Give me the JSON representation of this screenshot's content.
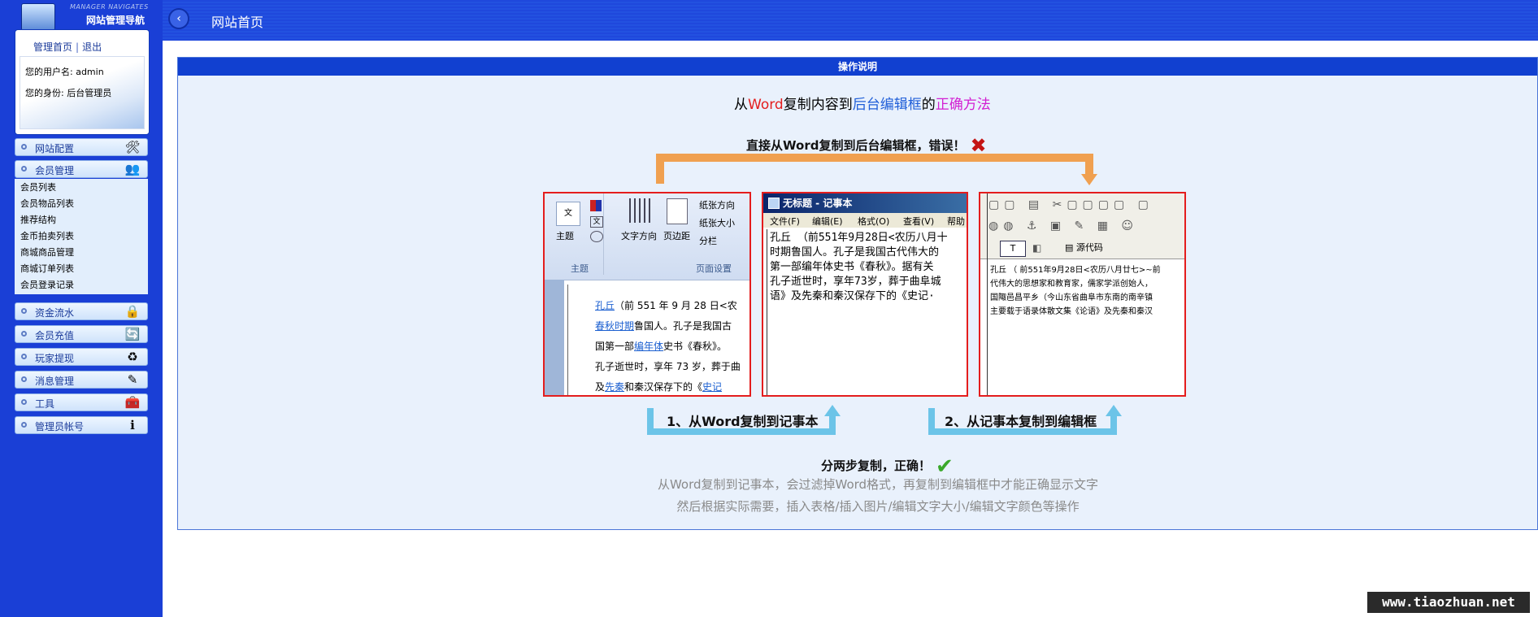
{
  "sidebar": {
    "logo_subtitle": "MANAGER NAVIGATES",
    "logo_title": "网站管理导航",
    "links": {
      "home": "管理首页",
      "sep": "|",
      "logout": "退出"
    },
    "user_line": "您的用户名: admin",
    "role_line": "您的身份: 后台管理员",
    "menus": [
      {
        "label": "网站配置",
        "icon": "tools-icon"
      },
      {
        "label": "会员管理",
        "icon": "users-icon"
      },
      {
        "label": "资金流水",
        "icon": "lock-icon"
      },
      {
        "label": "会员充值",
        "icon": "refresh-icon"
      },
      {
        "label": "玩家提现",
        "icon": "recycle-icon"
      },
      {
        "label": "消息管理",
        "icon": "edit-icon"
      },
      {
        "label": "工具",
        "icon": "toolbox-icon"
      },
      {
        "label": "管理员帐号",
        "icon": "info-icon"
      }
    ],
    "submenu": [
      "会员列表",
      "会员物品列表",
      "推荐结构",
      "金币拍卖列表",
      "商城商品管理",
      "商城订单列表",
      "会员登录记录"
    ]
  },
  "header": {
    "back_icon": "back-arrow-icon",
    "title": "网站首页"
  },
  "panel": {
    "heading": "操作说明",
    "main_title": {
      "p1": "从",
      "p2": "Word",
      "p3": "复制内容到",
      "p4": "后台编辑框",
      "p5": "的",
      "p6": "正确方法"
    },
    "wrong_label": "直接从Word复制到后台编辑框，错误！",
    "word_shot": {
      "ribbon": [
        "主题",
        "文字方向",
        "页边距",
        "纸张方向",
        "纸张大小",
        "分栏"
      ],
      "groups": [
        "主题",
        "页面设置"
      ],
      "text_l1a": "孔丘",
      "text_l1b": "（前 551 年 9 月 28 日<农",
      "text_l2a": "春秋时期",
      "text_l2b": "鲁国人。孔子是我国古",
      "text_l3a": "国第一部",
      "text_l3b": "编年体",
      "text_l3c": "史书《春秋》。",
      "text_l4": "孔子逝世时，享年 73 岁，葬于曲",
      "text_l5a": "及",
      "text_l5b": "先秦",
      "text_l5c": "和秦汉保存下的《",
      "text_l5d": "史记"
    },
    "notepad_shot": {
      "title": "无标题 - 记事本",
      "menus": [
        "文件(F)",
        "编辑(E)",
        "格式(O)",
        "查看(V)",
        "帮助"
      ],
      "lines": [
        "孔丘  （前551年9月28日<农历八月十",
        "时期鲁国人。孔子是我国古代伟大的",
        "第一部编年体史书《春秋》。据有关",
        "孔子逝世时，享年73岁，葬于曲阜城",
        "语》及先秦和秦汉保存下的《史记·"
      ]
    },
    "editor_shot": {
      "source_btn": "源代码",
      "lines": [
        "孔丘 （ 前551年9月28日<农历八月廿七>~前",
        "代伟大的思想家和教育家，儒家学派创始人，",
        "国陬邑昌平乡（今山东省曲阜市东南的南辛镇",
        "主要载于语录体散文集《论语》及先秦和秦汉"
      ]
    },
    "step1": "1、从Word复制到记事本",
    "step2": "2、从记事本复制到编辑框",
    "correct_label": "分两步复制，正确！",
    "note1": "从Word复制到记事本，会过滤掉Word格式，再复制到编辑框中才能正确显示文字",
    "note2": "然后根据实际需要，插入表格/插入图片/编辑文字大小/编辑文字颜色等操作"
  },
  "watermark": "www.tiaozhuan.net",
  "colors": {
    "sidebar": "#1a3fd6",
    "header": "#1f48dc",
    "panel_bg": "#e9f1fc",
    "wrong": "#e41d1d",
    "correct": "#3aa82a",
    "orange": "#f0a050",
    "blue_arrow": "#6cc4e8"
  }
}
